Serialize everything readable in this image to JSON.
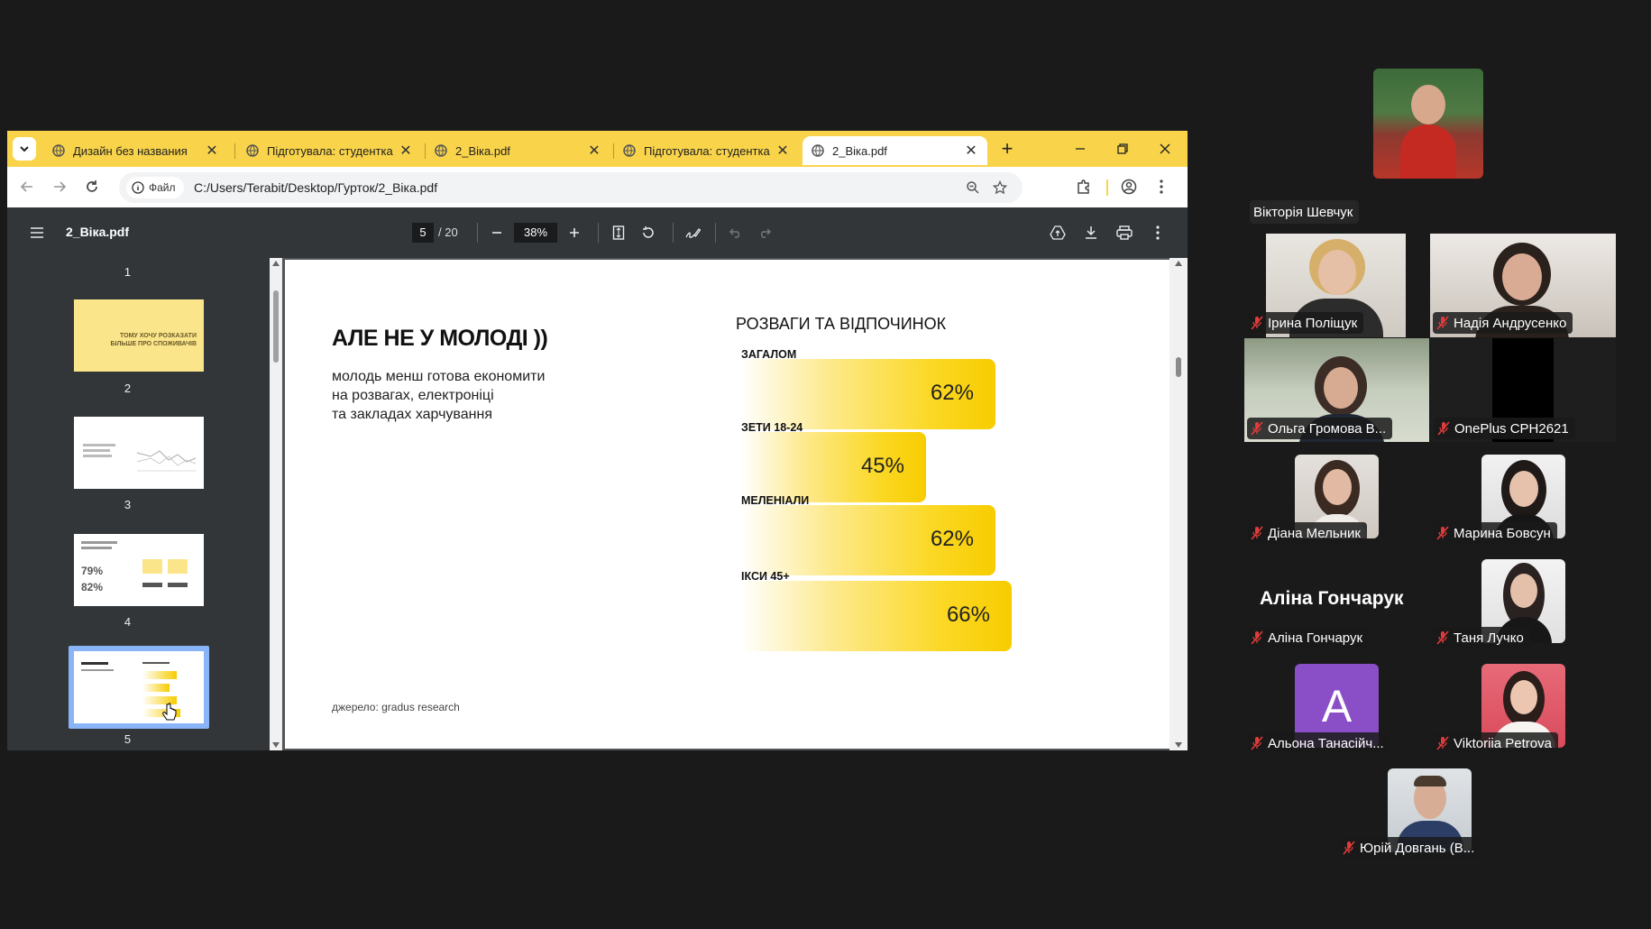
{
  "browser": {
    "tabs": [
      {
        "title": "Дизайн без названия",
        "active": false
      },
      {
        "title": "Підготувала: студентка г",
        "active": false
      },
      {
        "title": "2_Віка.pdf",
        "active": false
      },
      {
        "title": "Підготувала: студентка г",
        "active": false
      },
      {
        "title": "2_Віка.pdf",
        "active": true
      }
    ],
    "new_tab": "+",
    "address": {
      "chip": "Файл",
      "url": "C:/Users/Terabit/Desktop/Гурток/2_Віка.pdf"
    },
    "accent": "#f9d44a"
  },
  "pdf": {
    "filename": "2_Віка.pdf",
    "page": "5",
    "total": "/ 20",
    "zoom": "38%",
    "thumbnails": [
      {
        "num": "1",
        "text": []
      },
      {
        "num": "2",
        "text": [
          "ТОМУ ХОЧУ РОЗКАЗАТИ",
          "БІЛЬШЕ ПРО СПОЖИВАЧІВ"
        ]
      },
      {
        "num": "3",
        "text": []
      },
      {
        "num": "4",
        "text": [
          "79%",
          "82%"
        ]
      },
      {
        "num": "5",
        "text": []
      }
    ],
    "slide": {
      "title": "АЛЕ НЕ У МОЛОДІ ))",
      "subtitle_lines": [
        "молодь менш готова економити",
        "на розвагах, електроніці",
        "та закладах харчування"
      ],
      "source": "джерело: gradus research"
    }
  },
  "chart_data": {
    "type": "bar",
    "orientation": "horizontal",
    "title": "РОЗВАГИ ТА ВІДПОЧИНОК",
    "categories": [
      "ЗАГАЛОМ",
      "ЗЕТИ 18-24",
      "МЕЛЕНІАЛИ",
      "ІКСИ 45+"
    ],
    "values": [
      62,
      45,
      62,
      66
    ],
    "value_labels": [
      "62%",
      "45%",
      "62%",
      "66%"
    ],
    "unit": "%",
    "color": "#f7cc00"
  },
  "call": {
    "featured": {
      "name": "Вікторія Шевчук"
    },
    "participants": [
      {
        "name": "Ірина Поліщук",
        "kind": "video"
      },
      {
        "name": "Надія Андрусенко",
        "kind": "video"
      },
      {
        "name": "Ольга Громова В...",
        "kind": "video"
      },
      {
        "name": "OnePlus CPH2621",
        "kind": "black"
      },
      {
        "name": "Діана Мельник",
        "kind": "photo"
      },
      {
        "name": "Марина Бовсун",
        "kind": "photo"
      },
      {
        "name": "Аліна Гончарук",
        "kind": "text",
        "display": "Аліна Гончарук"
      },
      {
        "name": "Таня Лучко",
        "kind": "photo"
      },
      {
        "name": "Альона Танасійч...",
        "kind": "avatar",
        "initial": "A",
        "color": "#8a4fc7"
      },
      {
        "name": "Viktoriia Petrova",
        "kind": "photo"
      },
      {
        "name": "Юрій Довгань (В...",
        "kind": "photo"
      }
    ]
  }
}
